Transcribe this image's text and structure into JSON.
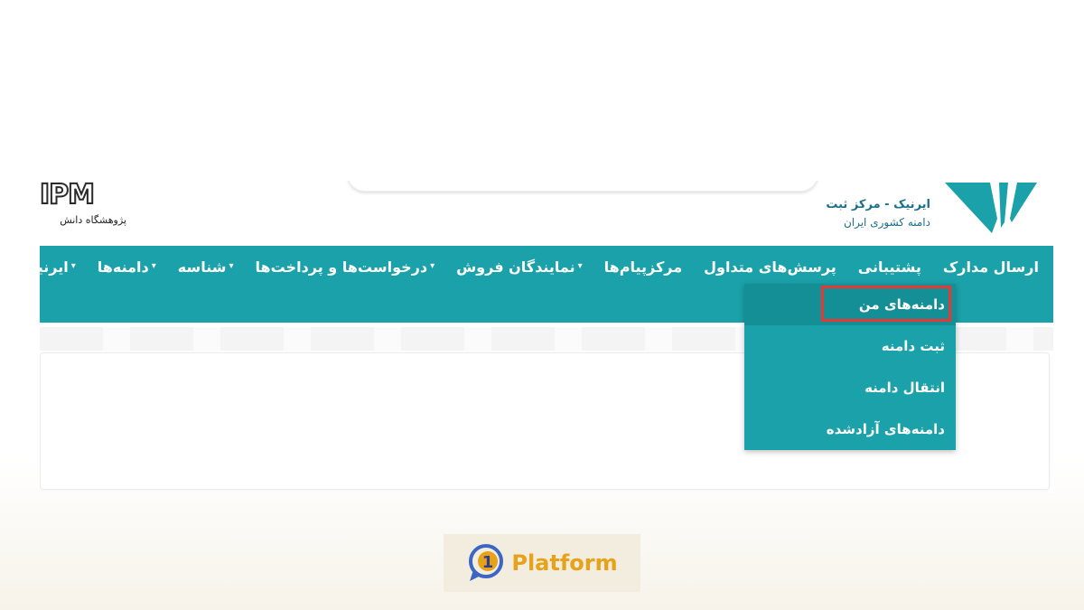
{
  "header": {
    "left_logo_text": "IPM",
    "left_logo_subtitle": "پژوهشگاه دانش",
    "right_logo_line1": "ایرنیک - مرکز ثبت",
    "right_logo_line2": "دامنه کشوری ایران"
  },
  "nav": {
    "items": [
      {
        "label": "ایرنیک",
        "has_caret": true
      },
      {
        "label": "دامنه‌ها",
        "has_caret": true
      },
      {
        "label": "شناسه",
        "has_caret": true
      },
      {
        "label": "درخواست‌ها و پرداخت‌ها",
        "has_caret": true
      },
      {
        "label": "نمایندگان فروش",
        "has_caret": true
      },
      {
        "label": "مرکزپیام‌ها",
        "has_caret": false
      },
      {
        "label": "پرسش‌های متداول",
        "has_caret": false
      },
      {
        "label": "پشتیبانی",
        "has_caret": false
      },
      {
        "label": "ارسال مدارک",
        "has_caret": false
      }
    ],
    "caret_glyph": "▾"
  },
  "dropdown": {
    "items": [
      {
        "label": "دامنه‌های من",
        "active": true
      },
      {
        "label": "ثبت دامنه",
        "active": false
      },
      {
        "label": "انتقال دامنه",
        "active": false
      },
      {
        "label": "دامنه‌های آزادشده",
        "active": false
      }
    ]
  },
  "watermark": {
    "digit": "1",
    "label": "Platform"
  },
  "colors": {
    "nav_bg": "#1ba1a9",
    "nav_active": "#158f96",
    "highlight": "#e53935",
    "brand_blue": "#1b6f8a",
    "watermark_gold": "#e8a21a",
    "watermark_blue": "#3b66c4"
  }
}
